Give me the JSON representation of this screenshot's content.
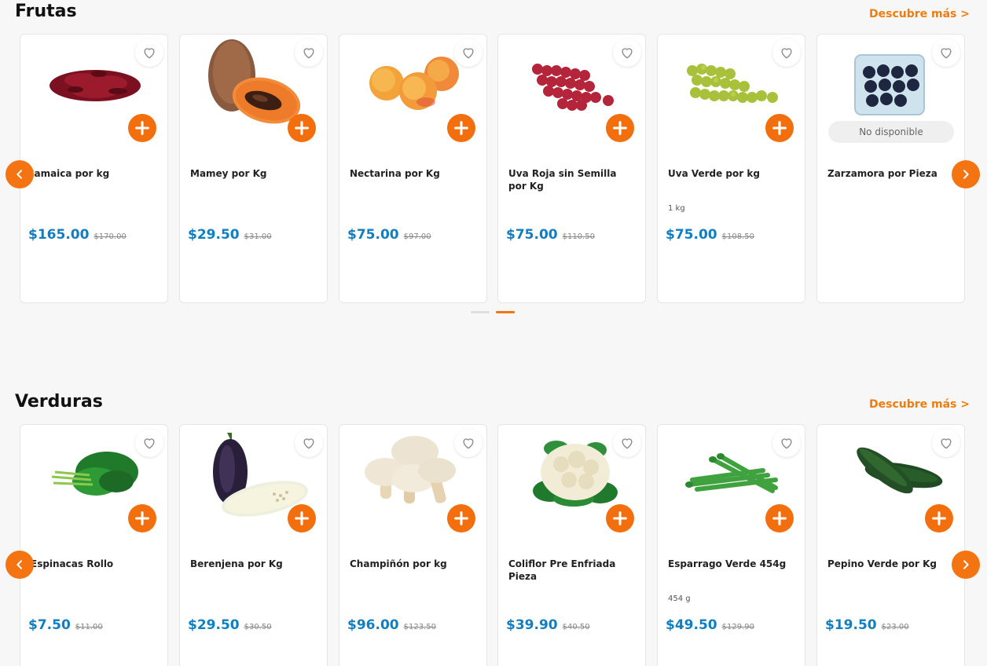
{
  "colors": {
    "accent": "#f37411",
    "price": "#0e7fc2",
    "link": "#f07c0d"
  },
  "frutas": {
    "title": "Frutas",
    "discover": "Descubre más >",
    "products": [
      {
        "name": "Jamaica por kg",
        "unit": "",
        "price": "$165.00",
        "old_price": "$170.00",
        "image": "hibiscus-flowers",
        "available": true
      },
      {
        "name": "Mamey por Kg",
        "unit": "",
        "price": "$29.50",
        "old_price": "$31.00",
        "image": "mamey-fruit",
        "available": true
      },
      {
        "name": "Nectarina por Kg",
        "unit": "",
        "price": "$75.00",
        "old_price": "$97.00",
        "image": "nectarines",
        "available": true
      },
      {
        "name": "Uva Roja sin Semilla por Kg",
        "unit": "",
        "price": "$75.00",
        "old_price": "$110.50",
        "image": "red-grapes",
        "available": true
      },
      {
        "name": "Uva Verde por kg",
        "unit": "1 kg",
        "price": "$75.00",
        "old_price": "$108.50",
        "image": "green-grapes",
        "available": true
      },
      {
        "name": "Zarzamora por Pieza",
        "unit": "",
        "price": "",
        "old_price": "",
        "image": "blackberries",
        "available": false,
        "unavailable_label": "No disponible"
      }
    ]
  },
  "verduras": {
    "title": "Verduras",
    "discover": "Descubre más >",
    "products": [
      {
        "name": "Espinacas Rollo",
        "unit": "",
        "price": "$7.50",
        "old_price": "$11.00",
        "image": "spinach"
      },
      {
        "name": "Berenjena por Kg",
        "unit": "",
        "price": "$29.50",
        "old_price": "$30.50",
        "image": "eggplant"
      },
      {
        "name": "Champiñón por kg",
        "unit": "",
        "price": "$96.00",
        "old_price": "$123.50",
        "image": "mushrooms"
      },
      {
        "name": "Coliflor Pre Enfriada Pieza",
        "unit": "",
        "price": "$39.90",
        "old_price": "$40.50",
        "image": "cauliflower"
      },
      {
        "name": "Esparrago Verde 454g",
        "unit": "454 g",
        "price": "$49.50",
        "old_price": "$129.90",
        "image": "asparagus"
      },
      {
        "name": "Pepino Verde por Kg",
        "unit": "",
        "price": "$19.50",
        "old_price": "$23.00",
        "image": "cucumbers"
      }
    ]
  },
  "icons": {
    "favorite": "heart-outline-icon",
    "add": "plus-icon",
    "prev": "chevron-left-icon",
    "next": "chevron-right-icon"
  }
}
